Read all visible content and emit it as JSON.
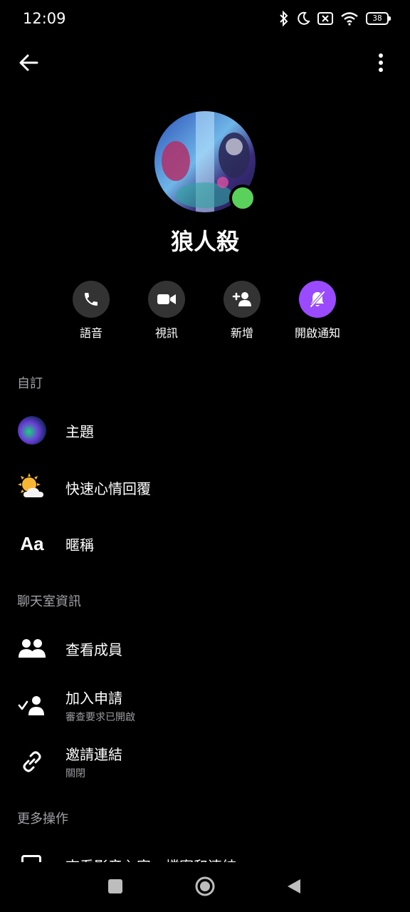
{
  "status_bar": {
    "time": "12:09",
    "battery": "38"
  },
  "group": {
    "name": "狼人殺"
  },
  "actions": [
    {
      "label": "語音",
      "icon": "phone-icon"
    },
    {
      "label": "視訊",
      "icon": "video-camera-icon"
    },
    {
      "label": "新增",
      "icon": "add-person-icon"
    },
    {
      "label": "開啟通知",
      "icon": "bell-muted-icon"
    }
  ],
  "sections": {
    "customize": "自訂",
    "chat_info": "聊天室資訊",
    "more_actions": "更多操作"
  },
  "customize_items": {
    "theme": "主題",
    "quick_reaction": "快速心情回覆",
    "nickname": "暱稱",
    "nickname_icon_text": "Aa"
  },
  "chat_info_items": {
    "members": "查看成員",
    "join_requests": {
      "title": "加入申請",
      "subtitle": "審查要求已開啟"
    },
    "invite_link": {
      "title": "邀請連結",
      "subtitle": "關閉"
    }
  },
  "more_actions_items": {
    "media_partial": "查看影音內容、檔案和連結"
  },
  "colors": {
    "background": "#000000",
    "action_circle": "#333334",
    "notify_accent": "#9b4bff",
    "online": "#5ad15a"
  }
}
